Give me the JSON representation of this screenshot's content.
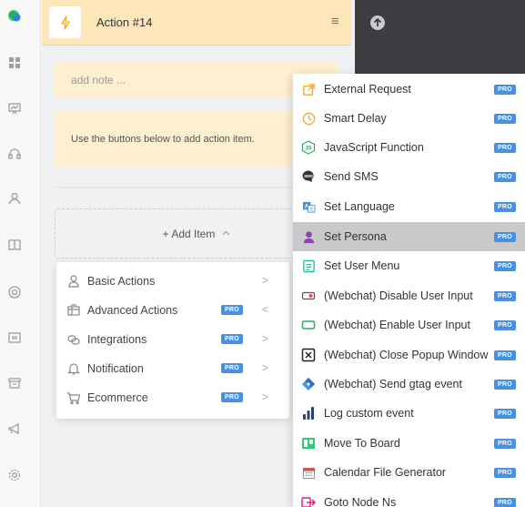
{
  "header": {
    "title": "Action #14",
    "menu_glyph": "≡"
  },
  "note": {
    "placeholder": "add note ..."
  },
  "info": {
    "text": "Use the buttons below to add action item."
  },
  "add_item": {
    "label": "+ Add Item",
    "chevron": "^"
  },
  "pro_label": "PRO",
  "categories": [
    {
      "label": "Basic Actions",
      "icon": "user-shape-icon",
      "pro": false,
      "arrow": ">"
    },
    {
      "label": "Advanced Actions",
      "icon": "panel-icon",
      "pro": true,
      "arrow": "<"
    },
    {
      "label": "Integrations",
      "icon": "link-icon",
      "pro": true,
      "arrow": ">"
    },
    {
      "label": "Notification",
      "icon": "bell-icon",
      "pro": true,
      "arrow": ">"
    },
    {
      "label": "Ecommerce",
      "icon": "cart-icon",
      "pro": true,
      "arrow": ">"
    }
  ],
  "actions": [
    {
      "label": "External Request",
      "icon": "external-link-icon",
      "selected": false
    },
    {
      "label": "Smart Delay",
      "icon": "clock-icon",
      "selected": false
    },
    {
      "label": "JavaScript Function",
      "icon": "javascript-icon",
      "selected": false
    },
    {
      "label": "Send SMS",
      "icon": "sms-icon",
      "selected": false
    },
    {
      "label": "Set Language",
      "icon": "translate-icon",
      "selected": false
    },
    {
      "label": "Set Persona",
      "icon": "persona-icon",
      "selected": true
    },
    {
      "label": "Set User Menu",
      "icon": "menu-list-icon",
      "selected": false
    },
    {
      "label": "(Webchat) Disable User Input",
      "icon": "input-disabled-icon",
      "selected": false
    },
    {
      "label": "(Webchat) Enable User Input",
      "icon": "input-enabled-icon",
      "selected": false
    },
    {
      "label": "(Webchat) Close Popup Window",
      "icon": "close-box-icon",
      "selected": false
    },
    {
      "label": "(Webchat) Send gtag event",
      "icon": "gtag-icon",
      "selected": false
    },
    {
      "label": "Log custom event",
      "icon": "bar-chart-icon",
      "selected": false
    },
    {
      "label": "Move To Board",
      "icon": "board-icon",
      "selected": false
    },
    {
      "label": "Calendar File Generator",
      "icon": "calendar-icon",
      "selected": false
    },
    {
      "label": "Goto Node Ns",
      "icon": "goto-icon",
      "selected": false
    }
  ],
  "rail_icons": [
    "chat-bubbles-icon",
    "grid-icon",
    "board-icon",
    "headset-icon",
    "user-icon",
    "book-icon",
    "lifebuoy-icon",
    "widget-icon",
    "archive-icon",
    "megaphone-icon",
    "settings-icon"
  ],
  "colors": {
    "header_bg": "#fde7b8",
    "note_bg": "#fdefd0",
    "pro_badge": "#4a90e2",
    "selected_row": "#c9c9cc",
    "dark_panel": "#3d3d41"
  }
}
